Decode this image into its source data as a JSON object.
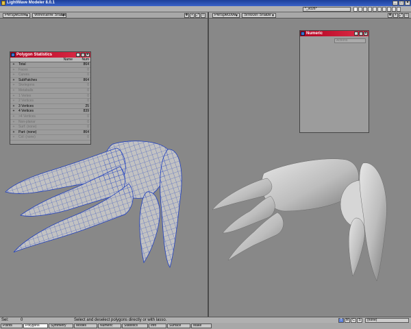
{
  "app": {
    "title": "LightWave Modeler 8.0.1",
    "window_buttons": [
      "_",
      "□",
      "×"
    ]
  },
  "top_right": {
    "layer_dropdown": "*_v026*",
    "layer_count": 10
  },
  "viewports": {
    "left": {
      "view_label": "Perspective",
      "shade_label": "Wireframe Shade",
      "tools": [
        "✥",
        "+",
        "⤢",
        "□"
      ]
    },
    "right": {
      "view_label": "Perspective",
      "shade_label": "Smooth Shade",
      "tools": [
        "✥",
        "+",
        "⤢",
        "□"
      ]
    }
  },
  "stats_panel": {
    "title": "Polygon Statistics",
    "col_name": "Name",
    "col_num": "Num",
    "rows": [
      {
        "label": "Total",
        "value": "864",
        "active": true
      },
      {
        "label": "Faces",
        "value": "0",
        "active": false
      },
      {
        "label": "Curves",
        "value": "0",
        "active": false
      },
      {
        "label": "SubPatches",
        "value": "864",
        "active": true
      },
      {
        "label": "Skelegons",
        "value": "0",
        "active": false
      },
      {
        "label": "Metaballs",
        "value": "0",
        "active": false
      },
      {
        "label": "1 Vertex",
        "value": "0",
        "active": false
      },
      {
        "label": "2 Vertices",
        "value": "0",
        "active": false
      },
      {
        "label": "3 Vertices",
        "value": "25",
        "active": true
      },
      {
        "label": "4 Vertices",
        "value": "839",
        "active": true
      },
      {
        "label": ">4 Vertices",
        "value": "0",
        "active": false
      },
      {
        "label": "Non-planar",
        "value": "0",
        "active": false
      },
      {
        "label": "Surf: (none)",
        "value": "0",
        "active": false
      },
      {
        "label": "Part: (none)",
        "value": "864",
        "active": true
      },
      {
        "label": "Col: (none)",
        "value": "0",
        "active": false
      }
    ]
  },
  "numeric_panel": {
    "title": "Numeric",
    "dropdown": "Actions"
  },
  "status": {
    "sel_label": "Sel:",
    "sel_value": "0",
    "hint": "Select and deselect polygons directly or with lasso.",
    "modes": [
      "T",
      "M",
      "C",
      "S"
    ],
    "surface_dropdown": "(none)"
  },
  "bottom_bar": {
    "buttons": [
      "Points",
      "Polygons",
      "Symmetry",
      "Modes",
      "Numeric",
      "Statistics",
      "Info",
      "Surface",
      "Make"
    ],
    "active": "Polygons"
  },
  "colors": {
    "wire": "#1f3fbf",
    "mesh_shade": "#bdbdbd",
    "panel_title": "#c81030"
  }
}
